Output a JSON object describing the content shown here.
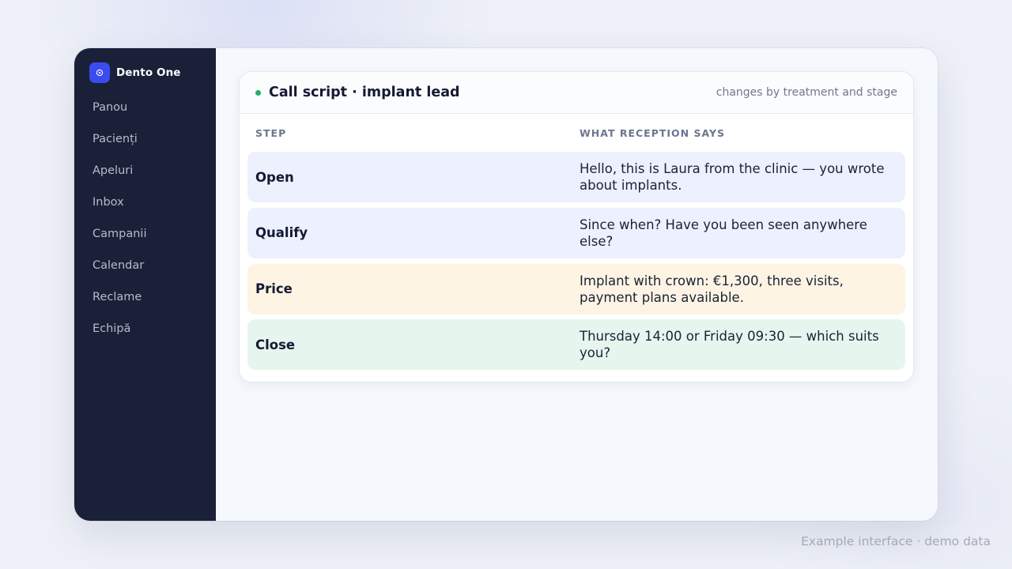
{
  "brand": {
    "name": "Dento One",
    "logo_icon": "tooth-logo-icon",
    "accent_color": "#3a4cf0"
  },
  "sidebar": {
    "items": [
      {
        "label": "Panou"
      },
      {
        "label": "Pacienți"
      },
      {
        "label": "Apeluri"
      },
      {
        "label": "Inbox"
      },
      {
        "label": "Campanii"
      },
      {
        "label": "Calendar"
      },
      {
        "label": "Reclame"
      },
      {
        "label": "Echipă"
      }
    ]
  },
  "card": {
    "title": "Call script · implant lead",
    "subtitle": "changes by treatment and stage",
    "status_color": "#19b364",
    "columns": {
      "step": "STEP",
      "say": "WHAT RECEPTION SAYS"
    },
    "rows": [
      {
        "step": "Open",
        "say": "Hello, this is Laura from the clinic — you wrote about implants.",
        "tone": "blue"
      },
      {
        "step": "Qualify",
        "say": "Since when? Have you been seen anywhere else?",
        "tone": "blue"
      },
      {
        "step": "Price",
        "say": "Implant with crown: €1,300, three visits, payment plans available.",
        "tone": "amber"
      },
      {
        "step": "Close",
        "say": "Thursday 14:00 or Friday 09:30 — which suits you?",
        "tone": "green"
      }
    ]
  },
  "footnote": "Example interface · demo data"
}
